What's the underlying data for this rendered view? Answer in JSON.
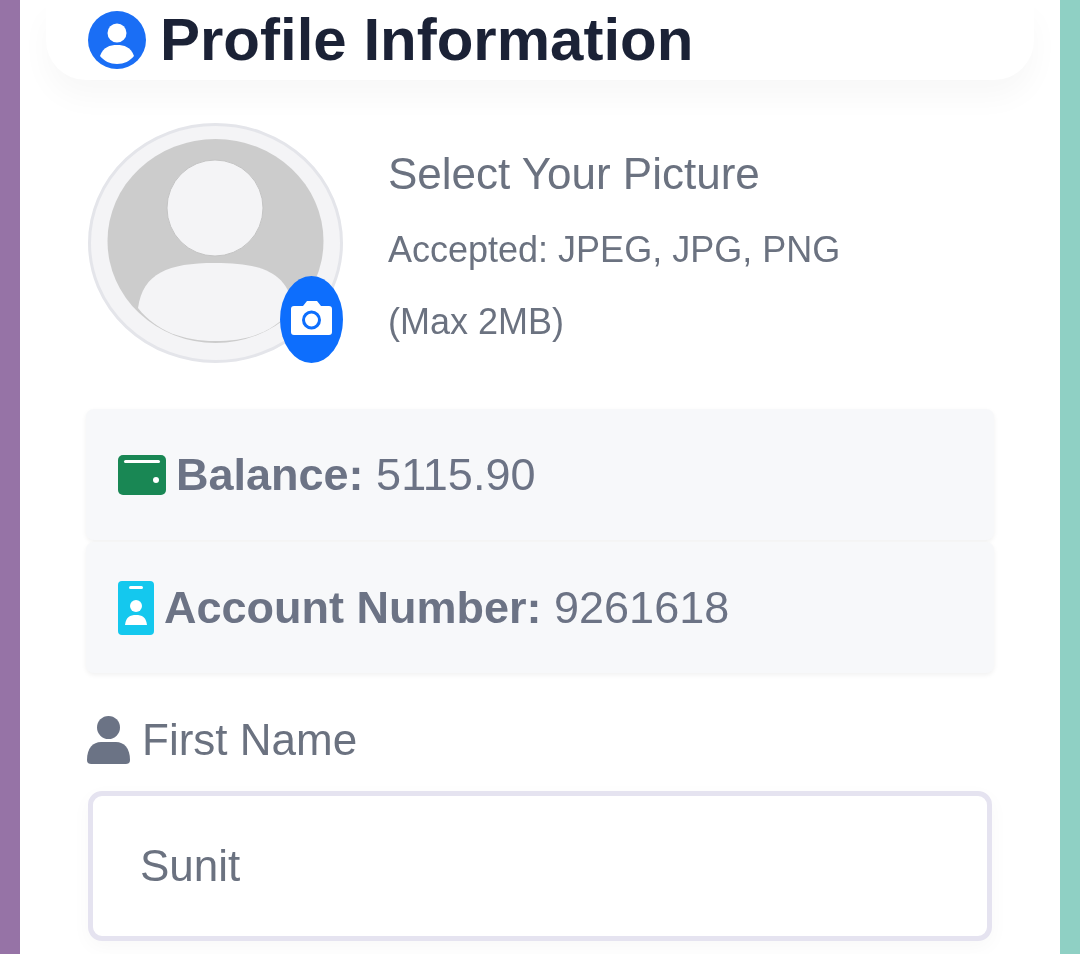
{
  "header": {
    "title": "Profile Information"
  },
  "picture": {
    "title": "Select Your Picture",
    "formats": "Accepted: JPEG, JPG, PNG",
    "max_size": "(Max 2MB)"
  },
  "info": [
    {
      "kind": "balance",
      "label": "Balance:",
      "value": "5115.90"
    },
    {
      "kind": "account",
      "label": "Account Number:",
      "value": "9261618"
    }
  ],
  "fields": [
    {
      "kind": "person",
      "label": "First Name",
      "value": "Sunit"
    }
  ]
}
